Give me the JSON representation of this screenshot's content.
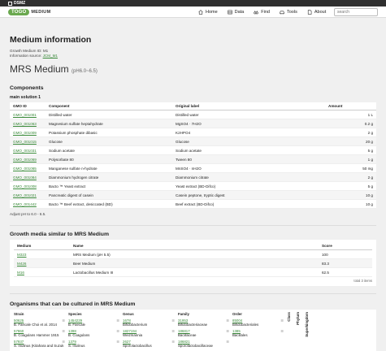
{
  "header": {
    "dsmz_label": "DSMZ",
    "logo_pill": "TOGO",
    "logo_text": "MEDIUM",
    "nav": [
      {
        "label": "Home",
        "icon": "home-icon"
      },
      {
        "label": "Data",
        "icon": "database-icon"
      },
      {
        "label": "Find",
        "icon": "binoculars-icon"
      },
      {
        "label": "Tools",
        "icon": "car-icon"
      },
      {
        "label": "About",
        "icon": "document-icon"
      }
    ],
    "search_placeholder": "search"
  },
  "page": {
    "title": "Medium information",
    "growth_medium_id": "Growth Medium ID: M1",
    "information_source_label": "Information source: ",
    "information_source_link": "JCM_M1",
    "medium_name": "MRS Medium",
    "medium_ph": "(pH6.0~6.5)"
  },
  "components": {
    "section_title": "Components",
    "solution_title": "main solution 1",
    "headers": [
      "GMO ID",
      "Component",
      "Original label",
      "Amount"
    ],
    "rows": [
      {
        "id": "GMO_001001",
        "component": "Distilled water",
        "label": "Distilled water",
        "amount": "1 L"
      },
      {
        "id": "GMO_001063",
        "component": "Magnesium sulfate heptahydrate",
        "label": "MgSO4 · 7H2O",
        "amount": "0.2 g"
      },
      {
        "id": "GMO_001009",
        "component": "Potassium phosphate dibasic",
        "label": "K2HPO4",
        "amount": "2 g"
      },
      {
        "id": "GMO_001015",
        "component": "Glucose",
        "label": "Glucose",
        "amount": "20 g"
      },
      {
        "id": "GMO_001031",
        "component": "Sodium acetate",
        "label": "Sodium acetate",
        "amount": "5 g"
      },
      {
        "id": "GMO_001069",
        "component": "Polysorbate 80",
        "label": "Tween 80",
        "amount": "1 g"
      },
      {
        "id": "GMO_001065",
        "component": "Manganese sulfate n-hydrate",
        "label": "MnSO4 · nH2O",
        "amount": "50 mg"
      },
      {
        "id": "GMO_001084",
        "component": "Diammonium hydrogen citrate",
        "label": "Diammonium citrate",
        "amount": "2 g"
      },
      {
        "id": "GMO_001008",
        "component": "Bacto ™ Yeast extract",
        "label": "Yeast extract (BD-Difco)",
        "amount": "5 g"
      },
      {
        "id": "GMO_001021",
        "component": "Pancreatic digest of casein",
        "label": "Casein peptone, tryptic digest",
        "amount": "10 g"
      },
      {
        "id": "GMO_001442",
        "component": "Bacto ™ Beef extract, desiccated (BD)",
        "label": "Beef extract (BD-Difco)",
        "amount": "10 g"
      }
    ],
    "note": "Adjust pH to 6.0 - 6.5."
  },
  "similar": {
    "title": "Growth media similar to MRS Medium",
    "headers": [
      "Medium",
      "Name",
      "Score"
    ],
    "rows": [
      {
        "medium": "M323",
        "name": "MRS Medium (pH 5.5)",
        "score": "100"
      },
      {
        "medium": "M426",
        "name": "Beer Medium",
        "score": "83.3"
      },
      {
        "medium": "M16",
        "name": "Lactobacillus Medium III",
        "score": "62.5"
      }
    ],
    "total": "total 3 items"
  },
  "organisms": {
    "title": "Organisms that can be cultured in MRS Medium",
    "headers": [
      "Strain",
      "Species",
      "Genus",
      "Family",
      "Order",
      "Class",
      "Phylum",
      "Superkingdom"
    ],
    "rows": [
      {
        "strain_id": "50625",
        "strain": "B. Faecale Choi et al. 2014",
        "species_id": "1454229",
        "species": "B. Faecale",
        "genus_id": "1678",
        "genus": "Bifidobacterium",
        "family_id": "31953",
        "family": "Bifidobacteriaceae",
        "order_id": "85004",
        "order": "Bifidobacteriales"
      },
      {
        "strain_id": "57860",
        "strain": "B. Coagulans Hammer 1915",
        "species_id": "1398",
        "species": "B. Coagulans",
        "genus_id": "1827194",
        "genus": "Weizmannia",
        "family_id": "186817",
        "family": "Bacillaceae",
        "order_id": "1385",
        "order": "Bacillales"
      },
      {
        "strain_id": "57937",
        "strain": "S. Inulinus (Kitahara and Suzuk",
        "species_id": "1379",
        "species": "S. Inulinus",
        "genus_id": "2627",
        "genus": "Sporolactobacillus",
        "family_id": "186821",
        "family": "Sporolactobacillaceae",
        "order_id": "",
        "order": ""
      }
    ]
  }
}
